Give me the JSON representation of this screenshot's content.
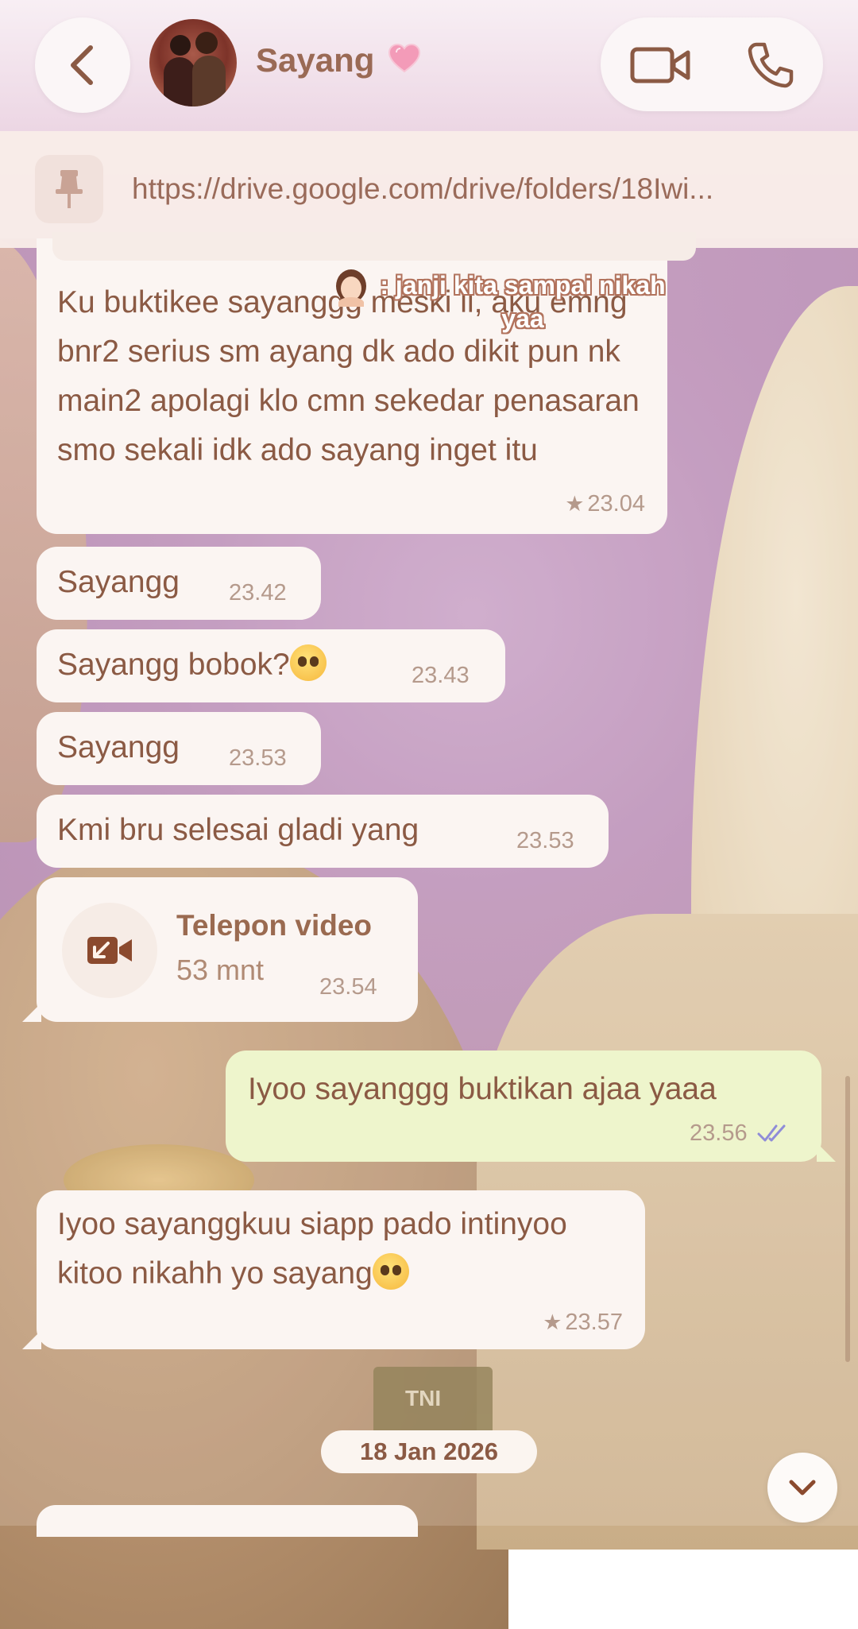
{
  "header": {
    "contact_name": "Sayang",
    "back_icon": "chevron-left-icon",
    "video_call_icon": "video-camera-icon",
    "voice_call_icon": "phone-icon"
  },
  "pinned": {
    "icon": "pin-icon",
    "link": "https://drive.google.com/drive/folders/18Iwi..."
  },
  "overlay_caption": ": janji kita sampai nikah yaa",
  "messages": [
    {
      "text": "Ku buktikee sayanggg meski ii, aku emng bnr2 serius sm ayang dk ado dikit pun nk main2 apolagi klo cmn sekedar penasaran smo sekali idk ado sayang inget itu",
      "time": "23.04",
      "starred": true,
      "direction": "in"
    },
    {
      "text": "Sayangg",
      "time": "23.42",
      "direction": "in"
    },
    {
      "text": "Sayangg bobok?",
      "time": "23.43",
      "direction": "in"
    },
    {
      "text": "Sayangg",
      "time": "23.53",
      "direction": "in"
    },
    {
      "text": "Kmi bru selesai gladi yang",
      "time": "23.53",
      "direction": "in"
    },
    {
      "text": "Iyoo sayanggg buktikan ajaa yaaa",
      "time": "23.56",
      "direction": "out",
      "status": "read"
    },
    {
      "text": "Iyoo sayanggkuu siapp pado intinyoo kitoo nikahh yo sayang",
      "time": "23.57",
      "starred": true,
      "direction": "in"
    }
  ],
  "call": {
    "title": "Telepon video",
    "duration": "53 mnt",
    "time": "23.54"
  },
  "star_glyph": "★",
  "date_separator": "18 Jan 2026",
  "colors": {
    "accent": "#9a6a55",
    "incoming_bubble": "#fbf5f2",
    "outgoing_bubble": "#eef5cc",
    "read_check": "#8f8cd8"
  }
}
